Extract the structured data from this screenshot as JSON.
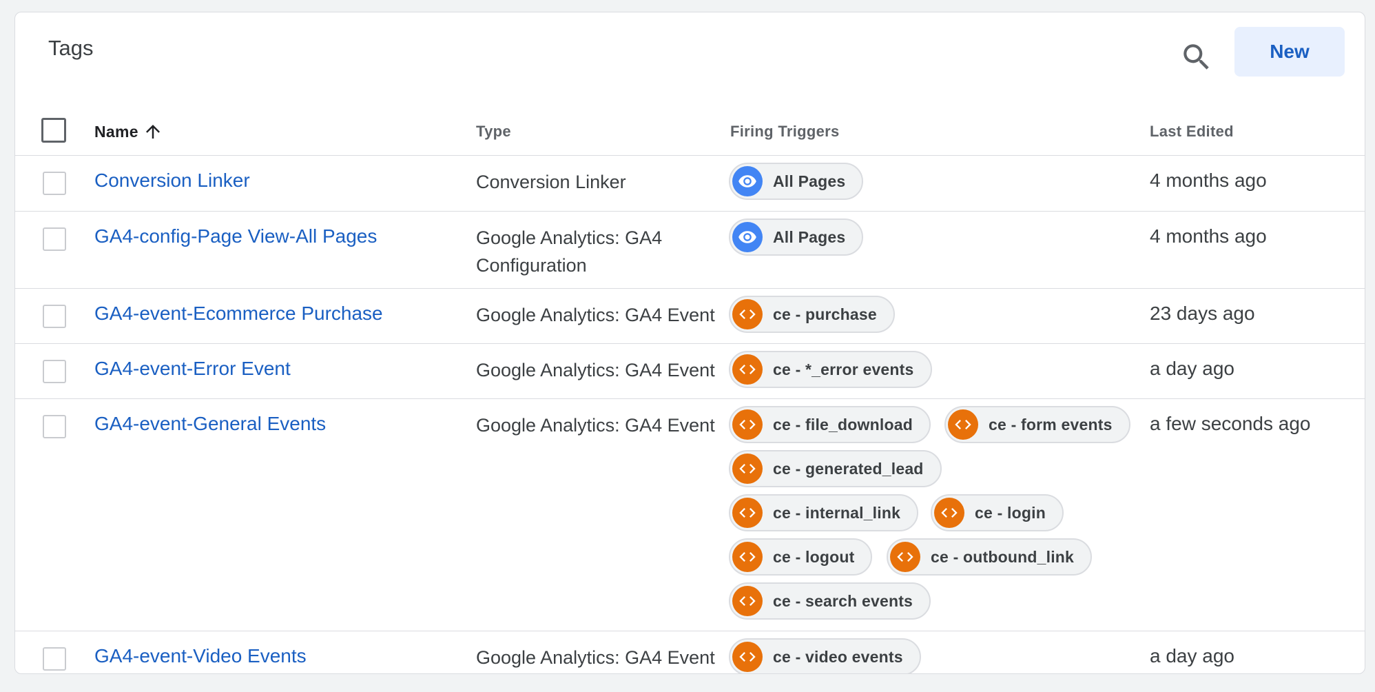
{
  "header": {
    "title": "Tags",
    "search_icon": "search-icon",
    "new_button_label": "New"
  },
  "columns": {
    "name": "Name",
    "name_sort": "ascending",
    "type": "Type",
    "firing_triggers": "Firing Triggers",
    "last_edited": "Last Edited"
  },
  "colors": {
    "link": "#1a5fc2",
    "page_view_trigger": "#4285f4",
    "custom_event_trigger": "#e8710a",
    "new_button_bg": "#e8f0fe"
  },
  "rows": [
    {
      "name": "Conversion Linker",
      "type": "Conversion Linker",
      "last_edited": "4 months ago",
      "triggers": [
        {
          "label": "All Pages",
          "icon": "eye-icon"
        }
      ]
    },
    {
      "name": "GA4-config-Page View-All Pages",
      "type": "Google Analytics: GA4 Configuration",
      "last_edited": "4 months ago",
      "triggers": [
        {
          "label": "All Pages",
          "icon": "eye-icon"
        }
      ]
    },
    {
      "name": "GA4-event-Ecommerce Purchase",
      "type": "Google Analytics: GA4 Event",
      "last_edited": "23 days ago",
      "triggers": [
        {
          "label": "ce - purchase",
          "icon": "code-icon"
        }
      ]
    },
    {
      "name": "GA4-event-Error Event",
      "type": "Google Analytics: GA4 Event",
      "last_edited": "a day ago",
      "triggers": [
        {
          "label": "ce - *_error events",
          "icon": "code-icon"
        }
      ]
    },
    {
      "name": "GA4-event-General Events",
      "type": "Google Analytics: GA4 Event",
      "last_edited": "a few seconds ago",
      "triggers": [
        {
          "label": "ce - file_download",
          "icon": "code-icon"
        },
        {
          "label": "ce - form events",
          "icon": "code-icon"
        },
        {
          "label": "ce - generated_lead",
          "icon": "code-icon"
        },
        {
          "label": "ce - internal_link",
          "icon": "code-icon"
        },
        {
          "label": "ce - login",
          "icon": "code-icon"
        },
        {
          "label": "ce - logout",
          "icon": "code-icon"
        },
        {
          "label": "ce - outbound_link",
          "icon": "code-icon"
        },
        {
          "label": "ce - search events",
          "icon": "code-icon"
        }
      ]
    },
    {
      "name": "GA4-event-Video Events",
      "type": "Google Analytics: GA4 Event",
      "last_edited": "a day ago",
      "triggers": [
        {
          "label": "ce - video events",
          "icon": "code-icon"
        }
      ]
    }
  ]
}
